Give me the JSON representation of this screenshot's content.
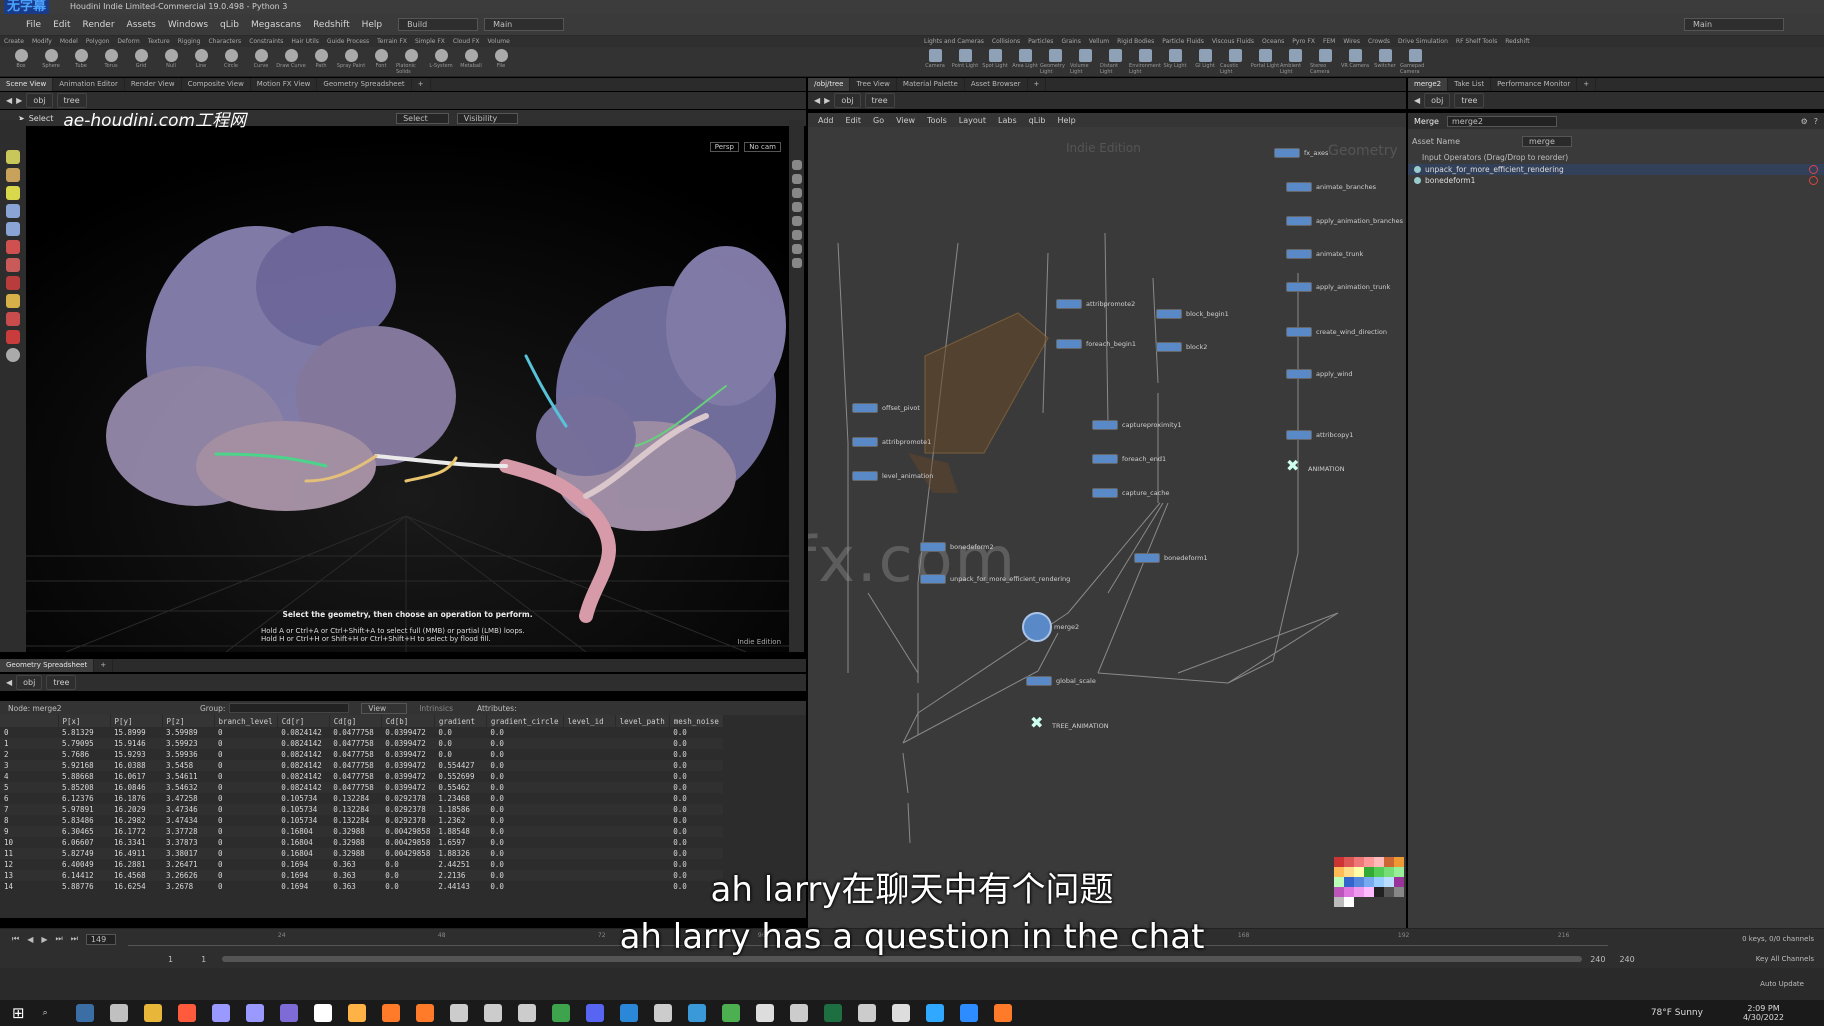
{
  "window": {
    "title": "Houdini Indie Limited-Commercial 19.0.498 - Python 3",
    "logo_text": "无字幕"
  },
  "menu": {
    "items": [
      "File",
      "Edit",
      "Render",
      "Assets",
      "Windows",
      "qLib",
      "Megascans",
      "Redshift",
      "Help"
    ],
    "desktop": "Build",
    "layout": "Main",
    "right_desktop": "Main"
  },
  "shelf_tabs_left": [
    "Create",
    "Modify",
    "Model",
    "Polygon",
    "Deform",
    "Texture",
    "Rigging",
    "Characters",
    "Constraints",
    "Hair Utils",
    "Guide Process",
    "Terrain FX",
    "Simple FX",
    "Cloud FX",
    "Volume"
  ],
  "shelf_tools_left": [
    "Box",
    "Sphere",
    "Tube",
    "Torus",
    "Grid",
    "Null",
    "Line",
    "Circle",
    "Curve",
    "Draw Curve",
    "Path",
    "Spray Paint",
    "Font",
    "Platonic Solids",
    "L-System",
    "Metaball",
    "File"
  ],
  "shelf_tabs_right": [
    "Lights and Cameras",
    "Collisions",
    "Particles",
    "Grains",
    "Vellum",
    "Rigid Bodies",
    "Particle Fluids",
    "Viscous Fluids",
    "Oceans",
    "Pyro FX",
    "FEM",
    "Wires",
    "Crowds",
    "Drive Simulation",
    "RF Shelf Tools",
    "Redshift"
  ],
  "shelf_tools_right": [
    "Camera",
    "Point Light",
    "Spot Light",
    "Area Light",
    "Geometry Light",
    "Volume Light",
    "Distant Light",
    "Environment Light",
    "Sky Light",
    "GI Light",
    "Caustic Light",
    "Portal Light",
    "Ambient Light",
    "Stereo Camera",
    "VR Camera",
    "Switcher",
    "Gamepad Camera"
  ],
  "viewport_pane": {
    "tabs": [
      "Scene View",
      "Animation Editor",
      "Render View",
      "Composite View",
      "Motion FX View",
      "Geometry Spreadsheet"
    ],
    "path": [
      "obj",
      "tree"
    ],
    "select_label": "Select",
    "watermark_site": "ae-houdini.com工程网",
    "select_mode": "Select",
    "visibility": "Visibility",
    "persp": "Persp",
    "cam": "No cam",
    "hint_title": "Select the geometry, then choose an operation to perform.",
    "hint_line1": "Hold A or Ctrl+A or Ctrl+Shift+A to select full (MMB) or partial (LMB) loops.",
    "hint_line2": "Hold H or Ctrl+H or Shift+H or Ctrl+Shift+H to select by flood fill.",
    "edition": "Indie Edition"
  },
  "network_pane": {
    "tabs": [
      "/obj/tree",
      "Tree View",
      "Material Palette",
      "Asset Browser"
    ],
    "path": [
      "obj",
      "tree"
    ],
    "menu": [
      "Add",
      "Edit",
      "Go",
      "View",
      "Tools",
      "Layout",
      "Labs",
      "qLib",
      "Help"
    ],
    "edition_watermark": "Indie Edition",
    "context_label": "Geometry",
    "center_watermark": "iiivfx.com"
  },
  "nodes": [
    {
      "name": "fx_axes",
      "color": "w"
    },
    {
      "name": "animate_branches",
      "color": "g"
    },
    {
      "name": "apply_animation_branches",
      "color": "g"
    },
    {
      "name": "animate_trunk",
      "color": "g"
    },
    {
      "name": "apply_animation_trunk",
      "color": "g"
    },
    {
      "name": "attribpromote2",
      "color": "w"
    },
    {
      "name": "block_begin1",
      "color": "o"
    },
    {
      "name": "foreach_begin1",
      "color": "o"
    },
    {
      "name": "block2",
      "color": "w"
    },
    {
      "name": "create_wind_direction",
      "color": "w"
    },
    {
      "name": "apply_wind",
      "color": "w"
    },
    {
      "name": "offset_pivot",
      "color": "w"
    },
    {
      "name": "attribpromote1",
      "color": "w"
    },
    {
      "name": "level_animation",
      "color": "w"
    },
    {
      "name": "captureproximity1",
      "color": "w"
    },
    {
      "name": "foreach_end1",
      "color": "o"
    },
    {
      "name": "attribcopy1",
      "color": "w"
    },
    {
      "name": "ANIMATION",
      "color": "x"
    },
    {
      "name": "capture_cache",
      "color": "w"
    },
    {
      "name": "bonedeform2",
      "color": "w"
    },
    {
      "name": "unpack_for_more_efficient_rendering",
      "color": "w"
    },
    {
      "name": "bonedeform1",
      "color": "w"
    },
    {
      "name": "merge2",
      "color": "b"
    },
    {
      "name": "global_scale",
      "color": "g"
    },
    {
      "name": "TREE_ANIMATION",
      "color": "x"
    }
  ],
  "params_pane": {
    "tabs": [
      "merge2",
      "Take List",
      "Performance Monitor"
    ],
    "path": [
      "obj",
      "tree"
    ],
    "node_type": "Merge",
    "node_name": "merge2",
    "asset_name_label": "Asset Name",
    "asset_name_value": "merge",
    "input_header": "Input Operators (Drag/Drop to reorder)",
    "inputs": [
      "unpack_for_more_efficient_rendering",
      "bonedeform1"
    ]
  },
  "spreadsheet": {
    "tab": "Geometry Spreadsheet",
    "path": [
      "obj",
      "tree"
    ],
    "node_label": "Node: merge2",
    "group_label": "Group:",
    "view_label": "View",
    "intrinsics_label": "Intrinsics",
    "attributes_label": "Attributes:",
    "columns": [
      "",
      "P[x]",
      "P[y]",
      "P[z]",
      "branch_level",
      "Cd[r]",
      "Cd[g]",
      "Cd[b]",
      "gradient",
      "gradient_circle",
      "level_id",
      "level_path",
      "mesh_noise"
    ],
    "rows": [
      [
        "0",
        "5.81329",
        "15.8999",
        "3.59989",
        "0",
        "0.0824142",
        "0.0477758",
        "0.0399472",
        "0.0",
        "0.0",
        "",
        "",
        "0.0"
      ],
      [
        "1",
        "5.79095",
        "15.9146",
        "3.59923",
        "0",
        "0.0824142",
        "0.0477758",
        "0.0399472",
        "0.0",
        "0.0",
        "",
        "",
        "0.0"
      ],
      [
        "2",
        "5.7686",
        "15.9293",
        "3.59936",
        "0",
        "0.0824142",
        "0.0477758",
        "0.0399472",
        "0.0",
        "0.0",
        "",
        "",
        "0.0"
      ],
      [
        "3",
        "5.92168",
        "16.0388",
        "3.5458",
        "0",
        "0.0824142",
        "0.0477758",
        "0.0399472",
        "0.554427",
        "0.0",
        "",
        "",
        "0.0"
      ],
      [
        "4",
        "5.88668",
        "16.0617",
        "3.54611",
        "0",
        "0.0824142",
        "0.0477758",
        "0.0399472",
        "0.552699",
        "0.0",
        "",
        "",
        "0.0"
      ],
      [
        "5",
        "5.85208",
        "16.0846",
        "3.54632",
        "0",
        "0.0824142",
        "0.0477758",
        "0.0399472",
        "0.55462",
        "0.0",
        "",
        "",
        "0.0"
      ],
      [
        "6",
        "6.12376",
        "16.1876",
        "3.47258",
        "0",
        "0.105734",
        "0.132284",
        "0.0292378",
        "1.23468",
        "0.0",
        "",
        "",
        "0.0"
      ],
      [
        "7",
        "5.97891",
        "16.2029",
        "3.47346",
        "0",
        "0.105734",
        "0.132284",
        "0.0292378",
        "1.18586",
        "0.0",
        "",
        "",
        "0.0"
      ],
      [
        "8",
        "5.83486",
        "16.2982",
        "3.47434",
        "0",
        "0.105734",
        "0.132284",
        "0.0292378",
        "1.2362",
        "0.0",
        "",
        "",
        "0.0"
      ],
      [
        "9",
        "6.30465",
        "16.1772",
        "3.37728",
        "0",
        "0.16804",
        "0.32988",
        "0.00429858",
        "1.88548",
        "0.0",
        "",
        "",
        "0.0"
      ],
      [
        "10",
        "6.06607",
        "16.3341",
        "3.37873",
        "0",
        "0.16804",
        "0.32988",
        "0.00429858",
        "1.6597",
        "0.0",
        "",
        "",
        "0.0"
      ],
      [
        "11",
        "5.82749",
        "16.4911",
        "3.38017",
        "0",
        "0.16804",
        "0.32988",
        "0.00429858",
        "1.88326",
        "0.0",
        "",
        "",
        "0.0"
      ],
      [
        "12",
        "6.40049",
        "16.2881",
        "3.26471",
        "0",
        "0.1694",
        "0.363",
        "0.0",
        "2.44251",
        "0.0",
        "",
        "",
        "0.0"
      ],
      [
        "13",
        "6.14412",
        "16.4568",
        "3.26626",
        "0",
        "0.1694",
        "0.363",
        "0.0",
        "2.2136",
        "0.0",
        "",
        "",
        "0.0"
      ],
      [
        "14",
        "5.88776",
        "16.6254",
        "3.2678",
        "0",
        "0.1694",
        "0.363",
        "0.0",
        "2.44143",
        "0.0",
        "",
        "",
        "0.0"
      ]
    ]
  },
  "timeline": {
    "frame": "149",
    "start": "1",
    "start2": "1",
    "end": "240",
    "end2": "240",
    "ticks": [
      "24",
      "48",
      "72",
      "96",
      "120",
      "144",
      "168",
      "192",
      "216"
    ],
    "keys": "0 keys, 0/0 channels",
    "key_all": "Key All Channels",
    "auto_update": "Auto Update"
  },
  "subtitle": {
    "cn": "ah larry在聊天中有个问题",
    "en": "ah larry has a question in the chat"
  },
  "taskbar": {
    "weather": "78°F Sunny",
    "time": "2:09 PM",
    "date": "4/30/2022",
    "app_colors": [
      "#3a6ea5",
      "#c0c0c0",
      "#e8b73a",
      "#ff5a3c",
      "#9999ff",
      "#9999ff",
      "#7f6bd6",
      "#ffffff",
      "#ffb347",
      "#ff7a29",
      "#ff7a29",
      "#cccccc",
      "#cccccc",
      "#cccccc",
      "#3da34d",
      "#5865f2",
      "#2b88d8",
      "#cccccc",
      "#3a9ad9",
      "#4caf50",
      "#dddddd",
      "#cccccc",
      "#1d6f42",
      "#cccccc",
      "#dddddd",
      "#31a8ff",
      "#2d8cff",
      "#ff7a29"
    ]
  },
  "colors": {
    "accent": "#ff7a29",
    "node_green": "#6fb43c",
    "node_orange": "#dd8a2a"
  }
}
